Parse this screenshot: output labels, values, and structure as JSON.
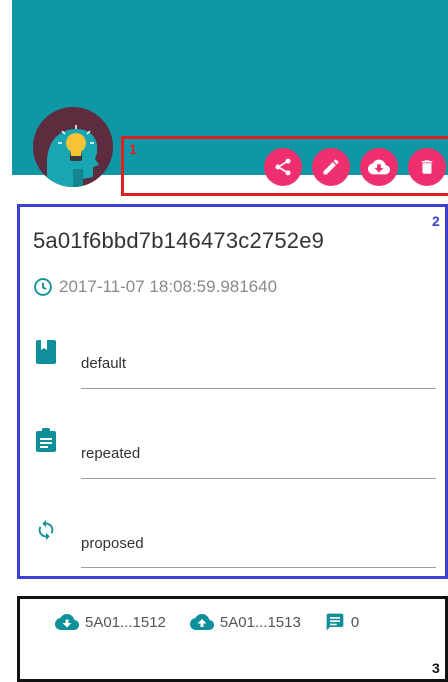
{
  "colors": {
    "brand": "#0f97a6",
    "accent": "#f0306e",
    "avatar_bg": "#5e2c3f",
    "icon_teal": "#0f8f9a"
  },
  "annotations": {
    "label_1": "1",
    "label_2": "2",
    "label_3": "3"
  },
  "toolbar": {
    "buttons": [
      {
        "icon": "share-icon"
      },
      {
        "icon": "edit-icon"
      },
      {
        "icon": "cloud-download-icon"
      },
      {
        "icon": "delete-icon"
      }
    ]
  },
  "card": {
    "title": "5a01f6bbd7b146473c2752e9",
    "timestamp": "2017-11-07 18:08:59.981640",
    "fields": [
      {
        "icon": "book-icon",
        "value": "default"
      },
      {
        "icon": "clipboard-icon",
        "value": "repeated"
      },
      {
        "icon": "sync-icon",
        "value": "proposed"
      }
    ]
  },
  "stats": {
    "download_id": "5A01...1512",
    "upload_id": "5A01...1513",
    "comment_count": "0"
  }
}
